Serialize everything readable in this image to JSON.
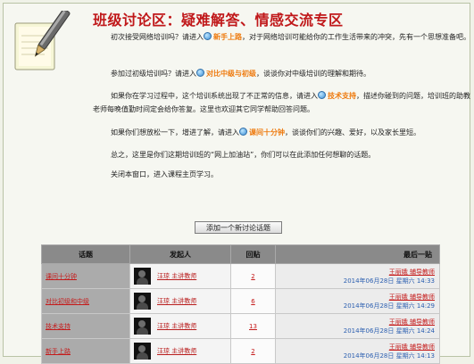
{
  "title": "班级讨论区：疑难解答、情感交流专区",
  "paragraphs": [
    {
      "before": "初次接受网络培训吗？请进入",
      "link": "新手上路",
      "after": "，对于网络培训可能给你的工作生活带来的冲突，先有一个思想准备吧。"
    },
    {
      "before": "参加过初级培训吗？请进入",
      "link": "对比中级与初级",
      "after": "，谈谈你对中级培训的理解和期待。"
    },
    {
      "before": "如果你在学习过程中，这个培训系统出现了不正常的信息，请进入",
      "link": "技术支持",
      "after": "，描述你碰到的问题，培训班的助教老师每晚值勤时间定会给你答复。这里也欢迎其它同学帮助回答问题。"
    },
    {
      "before": "如果你们想放松一下，增进了解，请进入",
      "link": "课间十分钟",
      "after": "，谈谈你们的兴趣、爱好，以及家长里短。"
    },
    {
      "before": "总之，这里是你们这期培训班的“网上加油站”，你们可以在此添加任何想聊的话题。",
      "link": "",
      "after": ""
    },
    {
      "before": "关闭本窗口，进入课程主页学习。",
      "link": "",
      "after": ""
    }
  ],
  "add_button": "添加一个新讨论话题",
  "table": {
    "headers": [
      "话题",
      "发起人",
      "回贴",
      "最后一贴"
    ],
    "rows": [
      {
        "topic": "课间十分钟",
        "user": "汪琼 主讲教师",
        "posts": "2",
        "last_user": "王丽娥 辅导教师",
        "last_date": "2014年06月28日 星期六 14:33"
      },
      {
        "topic": "对比初级和中级",
        "user": "汪琼 主讲教师",
        "posts": "6",
        "last_user": "王丽娥 辅导教师",
        "last_date": "2014年06月28日 星期六 14:29"
      },
      {
        "topic": "技术支持",
        "user": "汪琼 主讲教师",
        "posts": "13",
        "last_user": "王丽娥 辅导教师",
        "last_date": "2014年06月28日 星期六 14:24"
      },
      {
        "topic": "新手上路",
        "user": "汪琼 主讲教师",
        "posts": "2",
        "last_user": "王丽娥 辅导教师",
        "last_date": "2014年06月28日 星期六 14:13"
      }
    ]
  },
  "icons": {
    "header": "notepad-pen-icon",
    "link": "globe-icon"
  },
  "colors": {
    "title": "#c0181a",
    "link": "#ee7a0e",
    "header_bg": "#8a8a8a",
    "topic_bg": "#ababab"
  }
}
